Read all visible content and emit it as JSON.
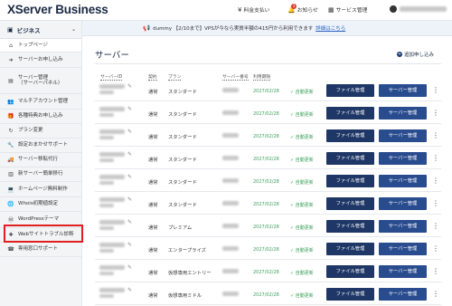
{
  "header": {
    "logo": "XServer Business",
    "nav": [
      {
        "label": "料金支払い",
        "icon": "yen-icon"
      },
      {
        "label": "お知らせ",
        "icon": "bell-icon",
        "badge": "3"
      },
      {
        "label": "サービス管理",
        "icon": "grid-icon"
      }
    ]
  },
  "sidebar": {
    "title": "ビジネス",
    "items": [
      {
        "label": "トップページ",
        "icon": "home-icon"
      },
      {
        "label": "サーバーお申し込み",
        "icon": "arrow-right-icon"
      },
      {
        "label": "サーバー管理",
        "sub": "（サーバーパネル）",
        "icon": "document-icon"
      },
      {
        "label": "マルチアカウント管理",
        "icon": "users-icon"
      },
      {
        "label": "各種特典お申し込み",
        "icon": "gift-icon"
      },
      {
        "label": "プラン変更",
        "icon": "refresh-icon"
      },
      {
        "label": "設定おまかせサポート",
        "icon": "wrench-icon"
      },
      {
        "label": "サーバー移転代行",
        "icon": "truck-icon"
      },
      {
        "label": "新サーバー簡単移行",
        "icon": "server-icon"
      },
      {
        "label": "ホームページ無料制作",
        "icon": "laptop-icon"
      },
      {
        "label": "Whois初期値設定",
        "icon": "globe-icon"
      },
      {
        "label": "WordPressテーマ",
        "icon": "wordpress-icon"
      },
      {
        "label": "Webサイトトラブル診断",
        "icon": "stethoscope-icon"
      },
      {
        "label": "専用窓口サポート",
        "icon": "headset-icon"
      }
    ]
  },
  "notice": {
    "text": "dummy 【2/10まで】VPSが今なら実質半額の415円から利用できます",
    "link": "詳細はこちら"
  },
  "main": {
    "title": "サーバー",
    "add_label": "追加申し込み",
    "columns": [
      "サーバーID",
      "契約",
      "プラン",
      "サーバー番号",
      "利用期限"
    ],
    "rows": [
      {
        "contract": "通常",
        "plan": "スタンダード"
      },
      {
        "contract": "通常",
        "plan": "スタンダード"
      },
      {
        "contract": "通常",
        "plan": "スタンダード"
      },
      {
        "contract": "通常",
        "plan": "スタンダード"
      },
      {
        "contract": "通常",
        "plan": "スタンダード"
      },
      {
        "contract": "通常",
        "plan": "スタンダード"
      },
      {
        "contract": "通常",
        "plan": "プレミアム"
      },
      {
        "contract": "通常",
        "plan": "エンタープライズ"
      },
      {
        "contract": "通常",
        "plan": "仮想専用エントリー"
      },
      {
        "contract": "通常",
        "plan": "仮想専用ミドル"
      }
    ],
    "expiry": "2027/02/28",
    "auto_renew": "自動更新",
    "file_btn": "ファイル管理",
    "server_btn": "サーバー管理"
  }
}
